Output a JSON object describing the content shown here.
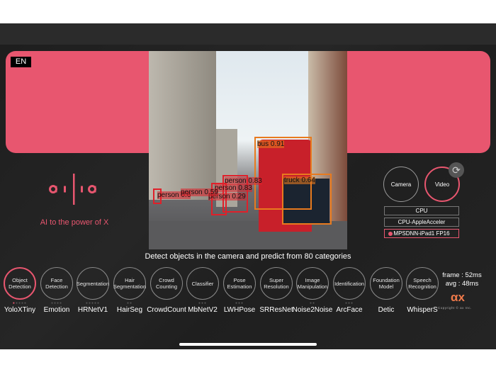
{
  "language_button": "EN",
  "tagline": "AI to the power of X",
  "caption": "Detect objects in the camera and predict from 80 categories",
  "source_buttons": [
    {
      "label": "Camera",
      "selected": false
    },
    {
      "label": "Video",
      "selected": true
    }
  ],
  "refresh_icon": "refresh-icon",
  "backends": [
    {
      "label": "CPU",
      "selected": false
    },
    {
      "label": "CPU-AppleAcceler",
      "selected": false
    },
    {
      "label": "MPSDNN-iPad1 FP16",
      "selected": true
    }
  ],
  "detections": [
    {
      "label": "bus 0.91",
      "color": "#e87a1e"
    },
    {
      "label": "truck 0.64",
      "color": "#e87a1e"
    },
    {
      "label": "person 0.83",
      "color": "#e0202a"
    },
    {
      "label": "person 0.83",
      "color": "#e0202a"
    },
    {
      "label": "person 0.29",
      "color": "#e0202a"
    },
    {
      "label": "person 0.6",
      "color": "#e0202a"
    },
    {
      "label": "person 0.59",
      "color": "#e0202a"
    }
  ],
  "tasks": [
    {
      "category": "Object Detection",
      "model": "YoloXTiny",
      "dots": 5,
      "active_dot": 1,
      "selected": true
    },
    {
      "category": "Face Detection",
      "model": "Emotion",
      "dots": 4
    },
    {
      "category": "Segmentation",
      "model": "HRNetV1",
      "dots": 5
    },
    {
      "category": "Hair Segmentation",
      "model": "HairSeg",
      "dots": 2
    },
    {
      "category": "Crowd Counting",
      "model": "CrowdCount",
      "dots": 0
    },
    {
      "category": "Classifier",
      "model": "MbNetV2",
      "dots": 3
    },
    {
      "category": "Pose Estimation",
      "model": "LWHPose",
      "dots": 3
    },
    {
      "category": "Super Resolution",
      "model": "SRResNet",
      "dots": 0
    },
    {
      "category": "Image Manipulation",
      "model": "Noise2Noise",
      "dots": 2
    },
    {
      "category": "Identification",
      "model": "ArcFace",
      "dots": 3
    },
    {
      "category": "Foundation Model",
      "model": "Detic",
      "dots": 0
    },
    {
      "category": "Speech Recognition",
      "model": "WhisperS",
      "dots": 0
    }
  ],
  "stats": {
    "frame": "frame : 52ms",
    "avg": "avg : 48ms"
  },
  "brand": {
    "logo_text": "ailia",
    "ax_logo": "ax",
    "copyright": "Copyright © ax Inc."
  },
  "colors": {
    "accent": "#e8566f",
    "background": "#222222"
  }
}
